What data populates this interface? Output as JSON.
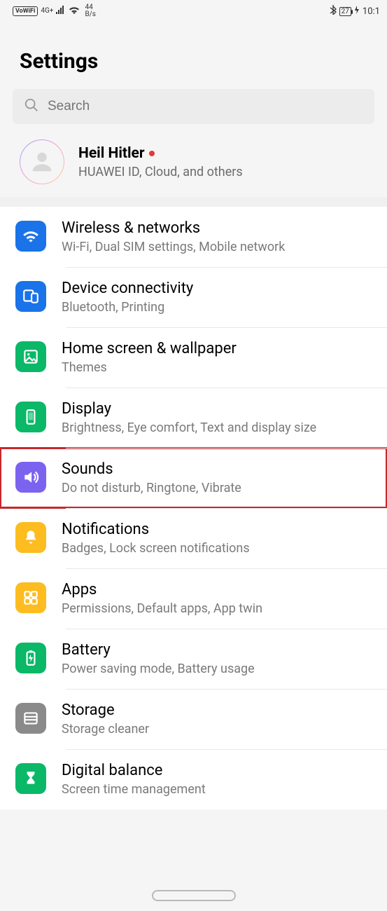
{
  "status": {
    "vowifi": "VoWiFi",
    "net": "4G+",
    "speed_top": "44",
    "speed_bot": "B/s",
    "battery": "27",
    "time": "10:1"
  },
  "header": {
    "title": "Settings"
  },
  "search": {
    "placeholder": "Search"
  },
  "account": {
    "name": "Heil Hitler",
    "sub": "HUAWEI ID, Cloud, and others"
  },
  "items": [
    {
      "title": "Wireless & networks",
      "sub": "Wi-Fi, Dual SIM settings, Mobile network"
    },
    {
      "title": "Device connectivity",
      "sub": "Bluetooth, Printing"
    },
    {
      "title": "Home screen & wallpaper",
      "sub": "Themes"
    },
    {
      "title": "Display",
      "sub": "Brightness, Eye comfort, Text and display size"
    },
    {
      "title": "Sounds",
      "sub": "Do not disturb, Ringtone, Vibrate"
    },
    {
      "title": "Notifications",
      "sub": "Badges, Lock screen notifications"
    },
    {
      "title": "Apps",
      "sub": "Permissions, Default apps, App twin"
    },
    {
      "title": "Battery",
      "sub": "Power saving mode, Battery usage"
    },
    {
      "title": "Storage",
      "sub": "Storage cleaner"
    },
    {
      "title": "Digital balance",
      "sub": "Screen time management"
    }
  ]
}
